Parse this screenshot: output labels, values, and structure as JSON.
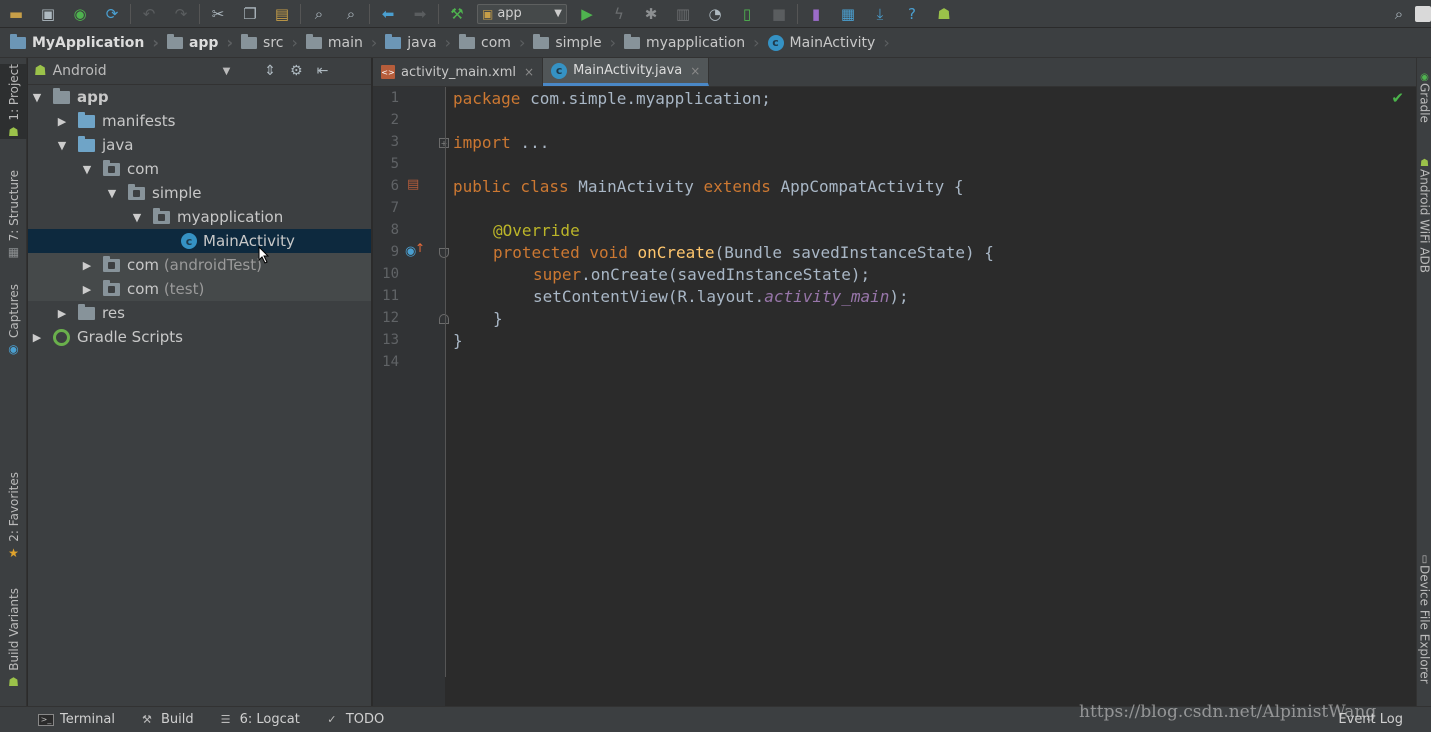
{
  "toolbar": {
    "icons": [
      "open-icon",
      "save-icon",
      "sync-icon",
      "refresh-icon",
      "undo-icon",
      "redo-icon",
      "cut-icon",
      "copy-icon",
      "paste-icon",
      "find-icon",
      "replace-icon",
      "back-icon",
      "forward-icon",
      "make-icon",
      "run-icon",
      "apply-changes-icon",
      "debug-icon",
      "attach-icon",
      "profile-icon",
      "device-icon",
      "stop-icon",
      "avd-manager-icon",
      "project-structure-icon",
      "sdk-manager-icon",
      "help-icon",
      "android-icon",
      "search-icon"
    ],
    "run_config": "app"
  },
  "breadcrumb": [
    "MyApplication",
    "app",
    "src",
    "main",
    "java",
    "com",
    "simple",
    "myapplication",
    "MainActivity"
  ],
  "left_stripe": {
    "tabs": [
      "1: Project",
      "7: Structure",
      "Captures",
      "2: Favorites",
      "Build Variants"
    ]
  },
  "right_stripe": {
    "tabs": [
      "Gradle",
      "Android WiFi ADB",
      "Device File Explorer"
    ]
  },
  "project_panel": {
    "view": "Android",
    "tree": [
      {
        "label": "app",
        "suffix": ""
      },
      {
        "label": "manifests",
        "suffix": ""
      },
      {
        "label": "java",
        "suffix": ""
      },
      {
        "label": "com",
        "suffix": ""
      },
      {
        "label": "simple",
        "suffix": ""
      },
      {
        "label": "myapplication",
        "suffix": ""
      },
      {
        "label": "MainActivity",
        "suffix": ""
      },
      {
        "label": "com ",
        "suffix": "(androidTest)"
      },
      {
        "label": "com ",
        "suffix": "(test)"
      },
      {
        "label": "res",
        "suffix": ""
      },
      {
        "label": "Gradle Scripts",
        "suffix": ""
      }
    ]
  },
  "editor_tabs": [
    {
      "label": "activity_main.xml",
      "close": "×"
    },
    {
      "label": "MainActivity.java",
      "close": "×"
    }
  ],
  "editor": {
    "line_numbers": [
      "1",
      "2",
      "3",
      "5",
      "6",
      "7",
      "8",
      "9",
      "10",
      "11",
      "12",
      "13",
      "14"
    ],
    "code": {
      "l1_kw": "package",
      "l1_rest": " com.simple.myapplication;",
      "l3_kw": "import",
      "l3_rest": " ...",
      "l6_kw1": "public class",
      "l6_name": " MainActivity ",
      "l6_kw2": "extends",
      "l6_rest": " AppCompatActivity {",
      "l8_ann": "@Override",
      "l9_kw": "protected void",
      "l9_fn": "onCreate",
      "l9_rest": "(Bundle savedInstanceState) {",
      "l10_kw": "super",
      "l10_rest": ".onCreate(savedInstanceState);",
      "l11_a": "setContentView(R.layout.",
      "l11_field": "activity_main",
      "l11_b": ");",
      "l12": "}",
      "l13": "}"
    }
  },
  "status_bar": {
    "items": [
      "Terminal",
      "Build",
      "6: Logcat",
      "TODO"
    ],
    "event_log": "Event Log"
  },
  "watermark": "https://blog.csdn.net/AlpinistWang"
}
